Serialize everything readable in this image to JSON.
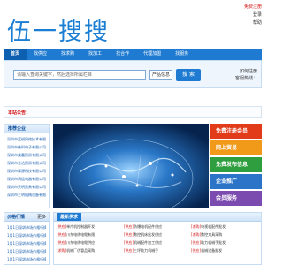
{
  "logo": {
    "text": "伍一搜搜"
  },
  "toplinks": {
    "register": "免费注册",
    "login": "登录",
    "help": "帮助"
  },
  "nav": {
    "items": [
      "首页",
      "找供应",
      "找求购",
      "找加工",
      "找合作",
      "代理加盟",
      "找服务"
    ]
  },
  "search": {
    "placeholder": "请输入查询关键字，然后选择所属栏目",
    "select_value": "产品信息",
    "button_label": "搜 索"
  },
  "hotline": {
    "line1": "如何注册",
    "line2": "客服热线："
  },
  "announce": {
    "label": "本站公告："
  },
  "companies": {
    "title": "推荐企业",
    "items": [
      "深圳市蓝锐网络技术有限公司",
      "深圳市伟科电子有限公司",
      "深圳市美嘉贸易有限公司",
      "深圳市金达贸易有限公司",
      "深圳市泰源科技有限公司",
      "深圳市鸿运电器有限公司",
      "深圳市天明贸易有限公司",
      "深圳市三明机械设备有限公司"
    ]
  },
  "side_ads": [
    "免费注册会员",
    "网上贸易",
    "免费发布信息",
    "企业推广",
    "会员服务"
  ],
  "prices": {
    "title": "价格行情",
    "more": "更多",
    "items": [
      "1月1日深圳市场价格行情",
      "1月1日深圳市场价格行情",
      "1月1日深圳市场价格行情",
      "1月1日深圳市场价格行情",
      "1月1日深圳市场价格行情"
    ]
  },
  "latest": {
    "title": "最新供求",
    "items": [
      {
        "tag": "[供应]",
        "text": "单片机控制器开发"
      },
      {
        "tag": "[供应]",
        "text": "防爆电机配件供应"
      },
      {
        "tag": "[求购]",
        "text": "电视机配件批发"
      },
      {
        "tag": "[供应]",
        "text": "川东电线电缆有限"
      },
      {
        "tag": "[供应]",
        "text": "数控机床批发供应"
      },
      {
        "tag": "[求购]",
        "text": "数控刀具采购"
      },
      {
        "tag": "[供应]",
        "text": "川东电线电缆供应"
      },
      {
        "tag": "[供应]",
        "text": "机械配件加工供应"
      },
      {
        "tag": "[供应]",
        "text": "助力机械手批发"
      },
      {
        "tag": "[求购]",
        "text": "机械厂仿冒品采购"
      },
      {
        "tag": "[供应]",
        "text": "三坪助力机械手"
      },
      {
        "tag": "[供应]",
        "text": "机械设备批发"
      }
    ]
  },
  "colors": {
    "brand": "#1f7bd1",
    "accent_red": "#d21010"
  }
}
